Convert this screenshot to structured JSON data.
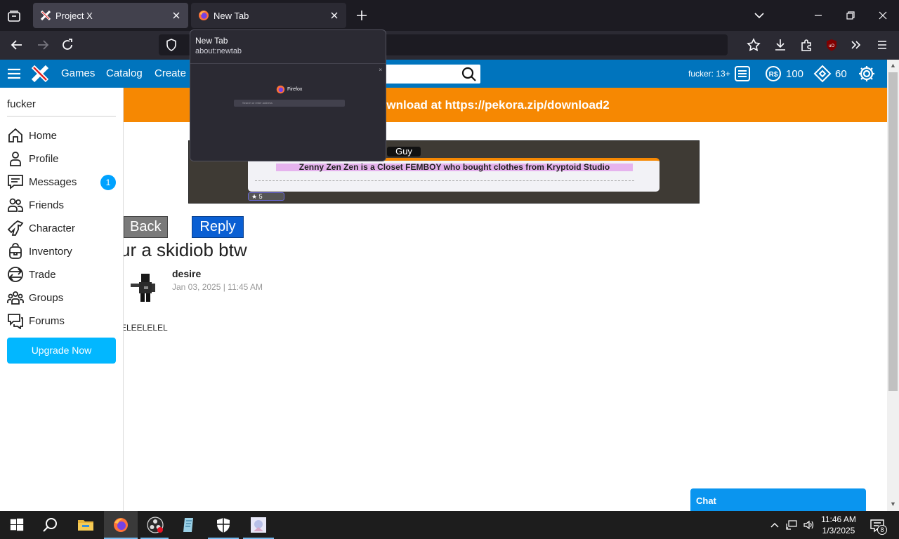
{
  "browser": {
    "tabs": [
      {
        "title": "Project X",
        "active": false
      },
      {
        "title": "New Tab",
        "active": true
      }
    ],
    "tab_preview": {
      "title": "New Tab",
      "url": "about:newtab",
      "thumbnail_logo_text": "Firefox",
      "thumbnail_search_placeholder": "Search or enter address"
    }
  },
  "site": {
    "nav": [
      "Games",
      "Catalog",
      "Create"
    ],
    "header_user": "fucker: 13+",
    "robux": "100",
    "tickets": "60",
    "alert_text": "ownload at https://pekora.zip/download2"
  },
  "sidebar": {
    "username": "fucker",
    "items": [
      {
        "label": "Home",
        "icon": "home-icon"
      },
      {
        "label": "Profile",
        "icon": "profile-icon"
      },
      {
        "label": "Messages",
        "icon": "messages-icon"
      },
      {
        "label": "Friends",
        "icon": "friends-icon"
      },
      {
        "label": "Character",
        "icon": "character-icon"
      },
      {
        "label": "Inventory",
        "icon": "inventory-icon"
      },
      {
        "label": "Trade",
        "icon": "trade-icon"
      },
      {
        "label": "Groups",
        "icon": "groups-icon"
      },
      {
        "label": "Forums",
        "icon": "forums-icon"
      }
    ],
    "messages_badge": "1",
    "upgrade_label": "Upgrade Now"
  },
  "post": {
    "image_tag": "Guy",
    "image_title": "Zenny Zen Zen is a Closet FEMBOY who bought clothes from Kryptoid Studio",
    "image_rating": "5",
    "back_label": "Back",
    "reply_label": "Reply",
    "thread_title": "ur a skidiob btw",
    "author": "desire",
    "date": "Jan 03, 2025 | 11:45 AM",
    "body": "ELEELELEL"
  },
  "chat": {
    "label": "Chat"
  },
  "taskbar": {
    "time": "11:46 AM",
    "date": "1/3/2025",
    "notifications": "8"
  },
  "colors": {
    "site_blue": "#0074bd",
    "alert_orange": "#f68802",
    "reply_blue": "#0a5fd3",
    "upgrade_blue": "#02b7ff",
    "chat_blue": "#0a95ef"
  }
}
